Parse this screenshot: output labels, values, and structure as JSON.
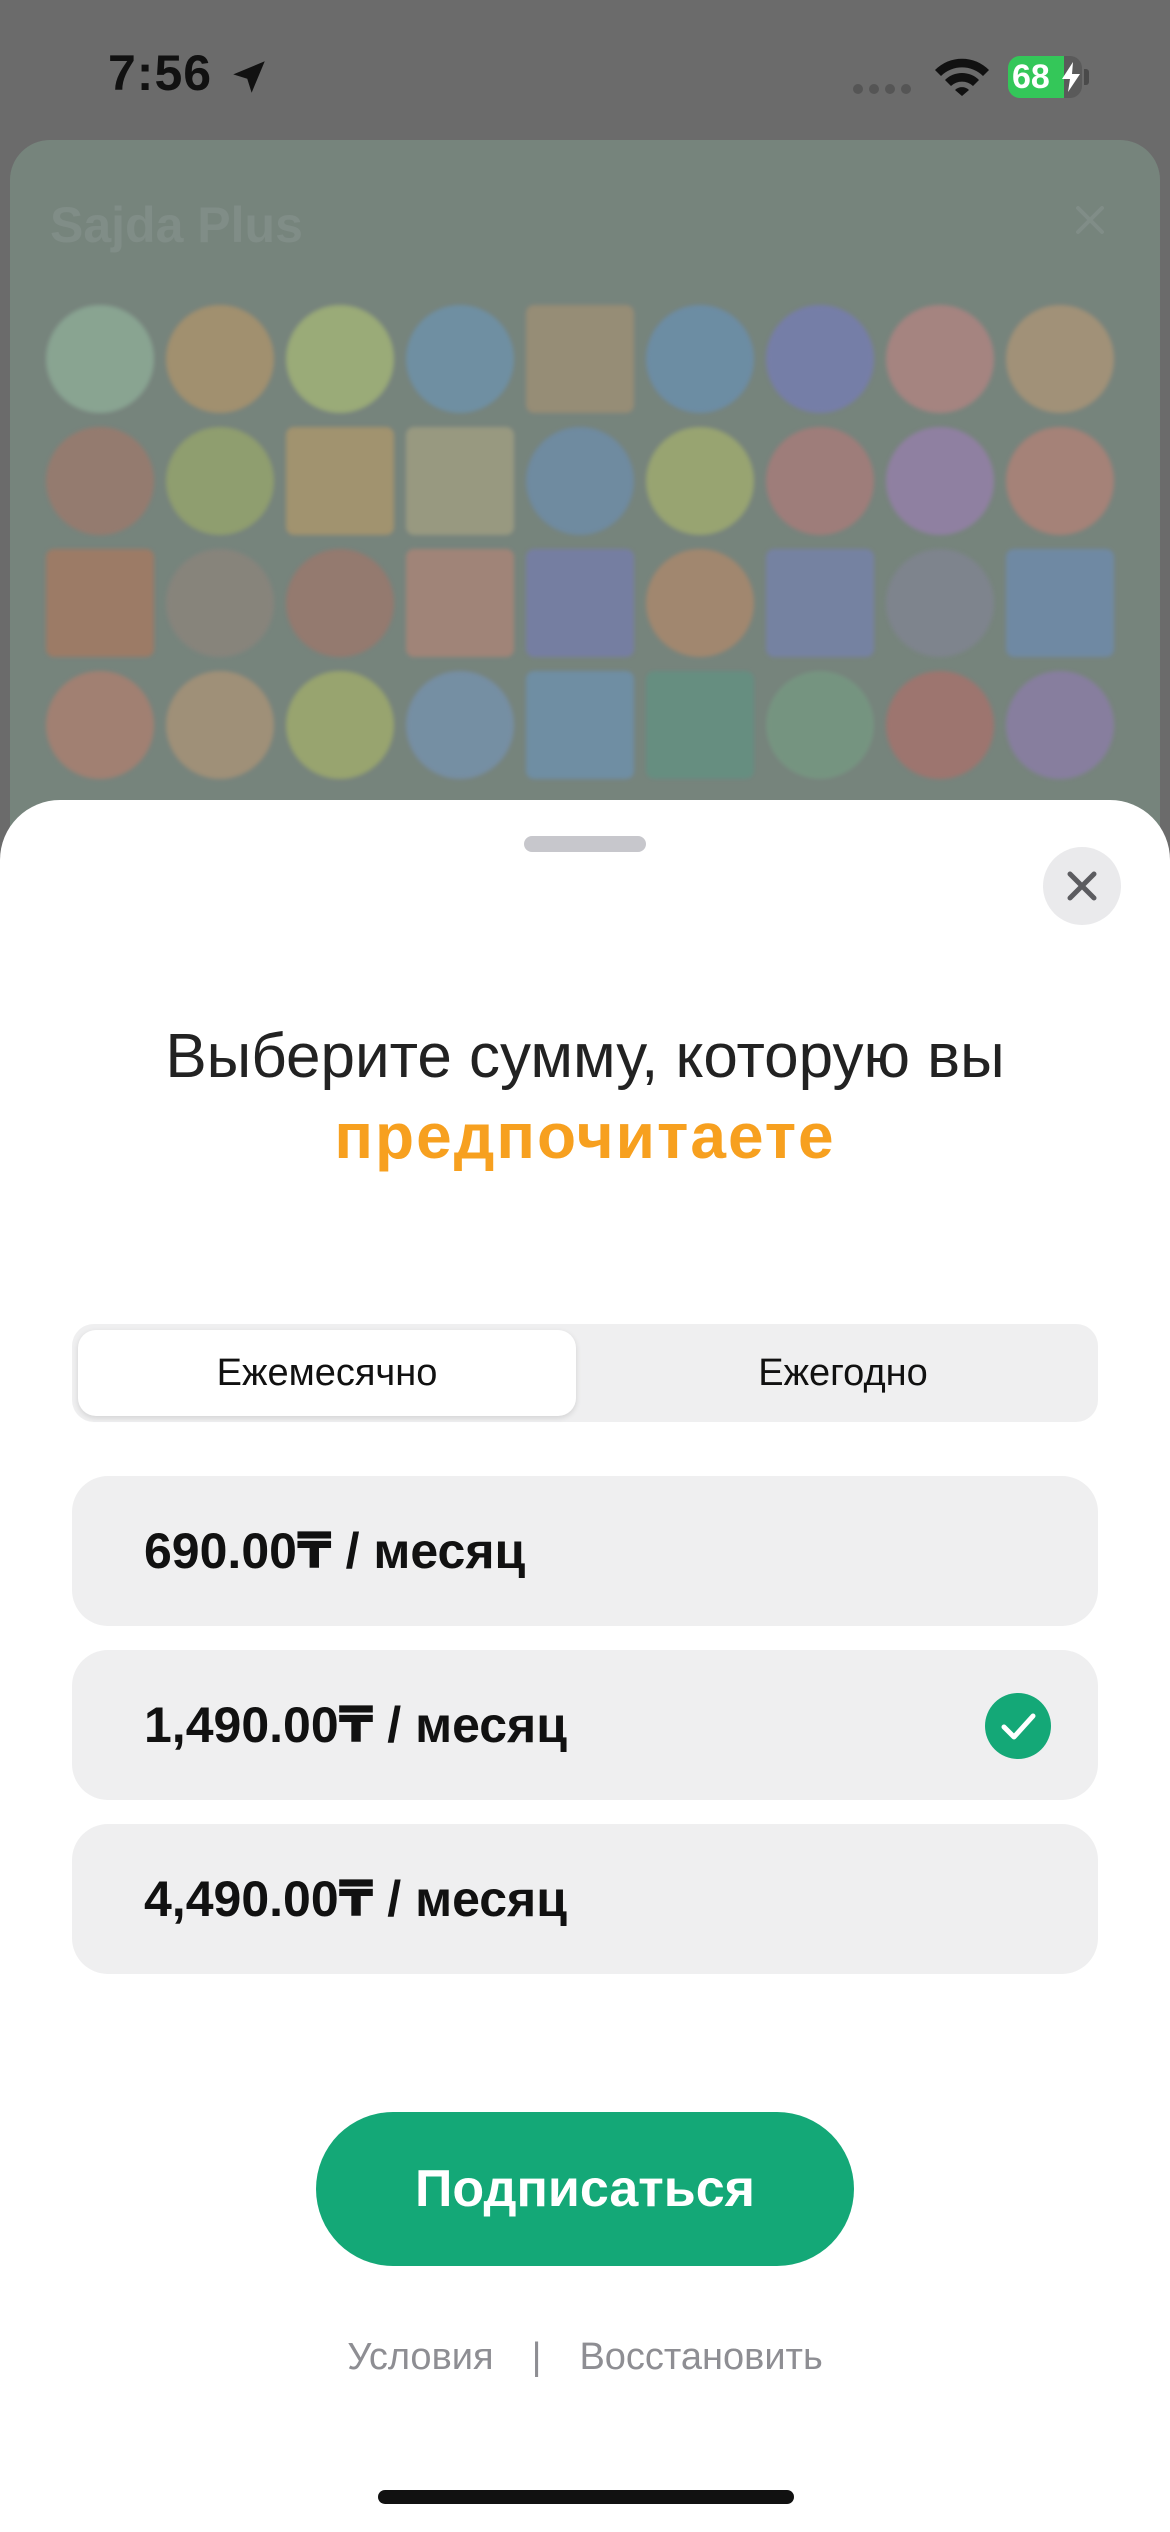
{
  "status_bar": {
    "time": "7:56",
    "battery_level": "68",
    "icons": [
      "location-arrow-icon",
      "signal-icon",
      "wifi-icon",
      "battery-charging-icon"
    ]
  },
  "background": {
    "title": "Sajda Plus"
  },
  "sheet": {
    "heading_line1": "Выберите сумму, которую вы",
    "heading_line2": "предпочитаете",
    "segments": {
      "monthly": "Ежемесячно",
      "yearly": "Ежегодно",
      "selected": "monthly"
    },
    "plans": [
      {
        "label": "690.00₸ / месяц",
        "selected": false
      },
      {
        "label": "1,490.00₸ / месяц",
        "selected": true
      },
      {
        "label": "4,490.00₸ / месяц",
        "selected": false
      }
    ],
    "subscribe_label": "Подписаться",
    "terms_label": "Условия",
    "separator": "|",
    "restore_label": "Восстановить"
  },
  "colors": {
    "accent_green": "#14a877",
    "highlight_orange": "#f7a01f",
    "battery_green": "#34c759"
  }
}
